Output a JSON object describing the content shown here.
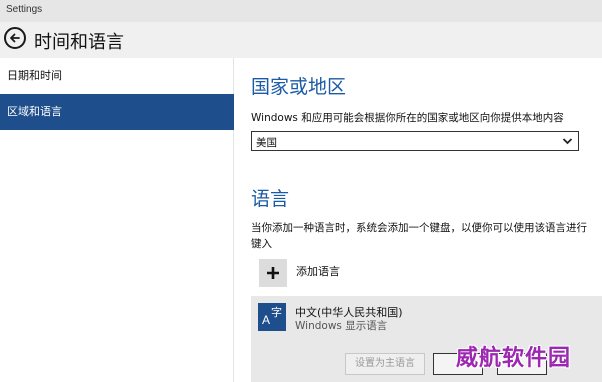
{
  "window": {
    "title": "Settings"
  },
  "header": {
    "title": "时间和语言"
  },
  "sidebar": {
    "items": [
      {
        "label": "日期和时间",
        "selected": false
      },
      {
        "label": "区域和语言",
        "selected": true
      }
    ]
  },
  "country": {
    "heading": "国家或地区",
    "description": "Windows 和应用可能会根据你所在的国家或地区向你提供本地内容",
    "selected": "美国"
  },
  "language": {
    "heading": "语言",
    "description": "当你添加一种语言时，系统会添加一个键盘，以便你可以使用该语言进行键入",
    "add_label": "添加语言",
    "items": [
      {
        "name": "中文(中华人民共和国)",
        "subtitle": "Windows 显示语言",
        "icon_text_a": "A",
        "icon_text_b": "字",
        "set_primary_label": "设置为主语言"
      }
    ]
  },
  "watermark": {
    "text": "威航软件园"
  },
  "colors": {
    "accent": "#1f4e8c",
    "heading": "#1a5aa6",
    "watermark": "#9c27b0"
  }
}
